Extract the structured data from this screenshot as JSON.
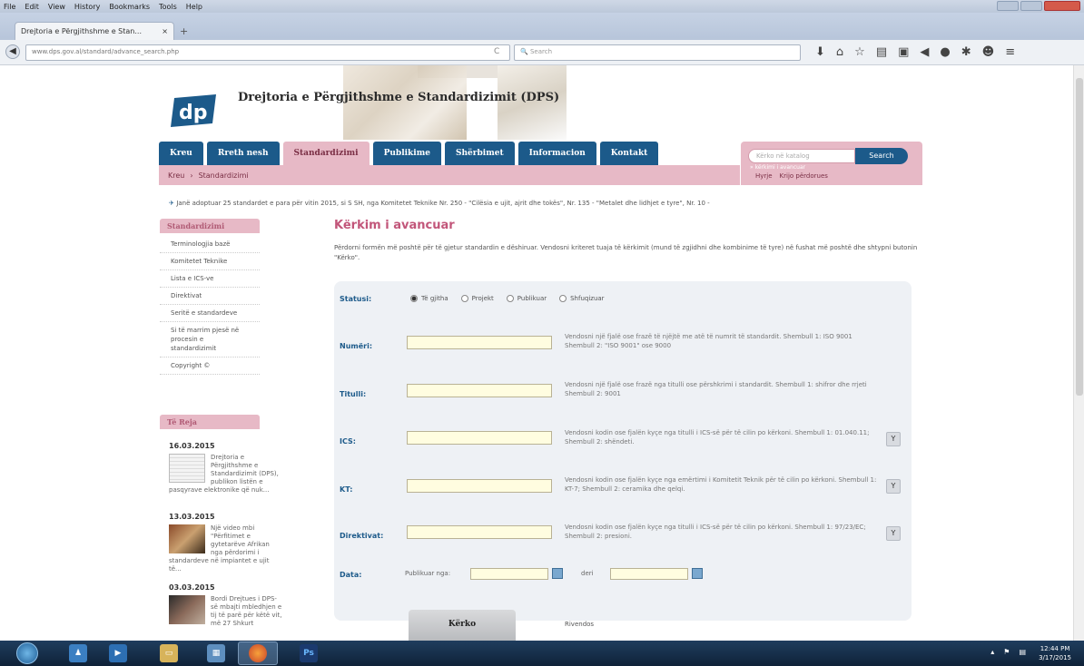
{
  "browser": {
    "menu": [
      "File",
      "Edit",
      "View",
      "History",
      "Bookmarks",
      "Tools",
      "Help"
    ],
    "tab_title": "Drejtoria e Përgjithshme e Stan...",
    "tab_close": "×",
    "new_tab": "+",
    "url": "www.dps.gov.al/standard/advance_search.php",
    "search_placeholder": "Search",
    "reload": "C"
  },
  "header": {
    "logo_text": "dp",
    "site_title": "Drejtoria e Përgjithshme e Standardizimit (DPS)"
  },
  "nav": {
    "items": [
      {
        "label": "Kreu"
      },
      {
        "label": "Rreth nesh"
      },
      {
        "label": "Standardizimi"
      },
      {
        "label": "Publikime"
      },
      {
        "label": "Shërbimet"
      },
      {
        "label": "Informacion"
      },
      {
        "label": "Kontakt"
      }
    ],
    "breadcrumb_home": "Kreu",
    "breadcrumb_sep": "›",
    "breadcrumb_current": "Standardizimi",
    "search_placeholder": "Kërko në katalog",
    "search_button": "Search",
    "search_small": "» kërkimi i avancuar",
    "login": "Hyrje",
    "register": "Krijo përdorues"
  },
  "ticker": "Janë adoptuar 25 standardet e para për vitin 2015, si S SH, nga Komitetet Teknike Nr. 250 - \"Cilësia e ujit, ajrit dhe tokës\", Nr. 135 - \"Metalet dhe lidhjet e tyre\", Nr. 10 -",
  "sidebar": {
    "heading": "Standardizimi",
    "items": [
      "Terminologjia bazë",
      "Komitetet Teknike",
      "Lista e ICS-ve",
      "Direktivat",
      "Seritë e standardeve",
      "Si të marrim pjesë në procesin e standardizimit",
      "Copyright ©"
    ],
    "news_heading": "Të Reja",
    "news": [
      {
        "date": "16.03.2015",
        "text": "Drejtoria e Përgjithshme e Standardizimit (DPS), publikon listën e pasqyrave elektronike që nuk..."
      },
      {
        "date": "13.03.2015",
        "text": "Një video mbi \"Përfitimet e gytetarëve Afrikan nga përdorimi i standardeve në impiantet e ujit të..."
      },
      {
        "date": "03.03.2015",
        "text": "Bordi Drejtues i DPS-së mbajti mbledhjen e tij të parë për këtë vit, më 27 Shkurt"
      }
    ]
  },
  "main": {
    "title": "Kërkim i avancuar",
    "description": "Përdorni formën më poshtë për të gjetur standardin e dëshiruar. Vendosni kriteret tuaja të kërkimit (mund të zgjidhni dhe kombinime të tyre) në fushat më poshtë dhe shtypni butonin \"Kërko\".",
    "status_label": "Statusi:",
    "status_options": [
      "Të gjitha",
      "Projekt",
      "Publikuar",
      "Shfuqizuar"
    ],
    "fields": [
      {
        "label": "Numëri:",
        "help": "Vendosni një fjalë ose frazë të njëjtë me atë të numrit të standardit. Shembull 1: ISO 9001 Shembull 2: \"ISO 9001\" ose 9000"
      },
      {
        "label": "Titulli:",
        "help": "Vendosni një fjalë ose frazë nga titulli ose përshkrimi i standardit. Shembull 1: shifror dhe rrjeti Shembull 2: 9001"
      },
      {
        "label": "ICS:",
        "help": "Vendosni kodin ose fjalën kyçe nga titulli i ICS-së për të cilin po kërkoni. Shembull 1: 01.040.11; Shembull 2: shëndeti."
      },
      {
        "label": "KT:",
        "help": "Vendosni kodin ose fjalën kyçe nga emërtimi i Komitetit Teknik për të cilin po kërkoni. Shembull 1: KT-7; Shembull 2: ceramika dhe qelqi."
      },
      {
        "label": "Direktivat:",
        "help": "Vendosni kodin ose fjalën kyçe nga titulli i ICS-së për të cilin po kërkoni. Shembull 1: 97/23/EC; Shembull 2: presioni."
      }
    ],
    "y_button": "Y",
    "date_label": "Data:",
    "date_from": "Publikuar nga:",
    "date_to": "deri",
    "search_button": "Kërko",
    "reset": "Rivendos"
  },
  "taskbar": {
    "time": "12:44 PM",
    "date": "3/17/2015",
    "ps_label": "Ps"
  }
}
